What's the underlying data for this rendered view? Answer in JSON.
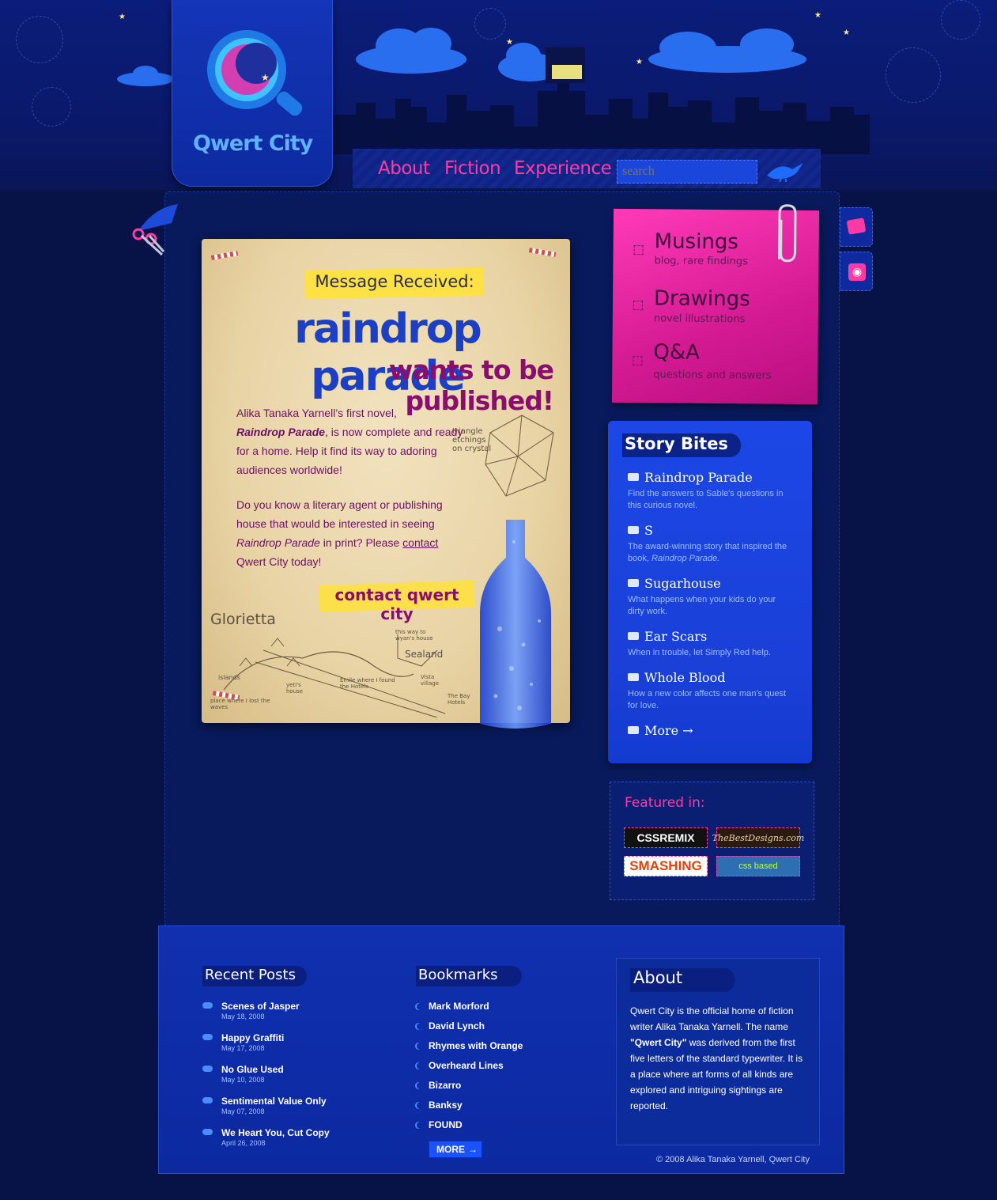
{
  "site": {
    "logo_text": "Qwert City"
  },
  "nav": {
    "items": [
      "About",
      "Fiction",
      "Experience"
    ],
    "search_placeholder": "search"
  },
  "hero": {
    "badge": "Message Received:",
    "title": "raindrop parade",
    "subtitle": "wants to be published!",
    "p1_a": "Alika Tanaka Yarnell’s first novel,",
    "p1_em": "Raindrop Parade",
    "p1_b": ", is now complete and ready for a home. Help it find its way to adoring audiences worldwide!",
    "p2_a": "Do you know a literary agent or publishing house that would be interested in seeing",
    "p2_em": "Raindrop Parade",
    "p2_b": "in print? Please",
    "p2_link": "contact",
    "p2_c": "Qwert City today!",
    "cta": "contact qwert city",
    "sketch_crystal": "triangle etchings on crystal",
    "sketch_glorietta": "Glorietta",
    "sketch_sealand": "Sealand",
    "sketch_note": "this way to wyan's house",
    "sketch_islands": "islands",
    "sketch_vista": "Vista village",
    "sketch_yetis": "yeti's house",
    "sketch_emile": "Emile where I found the Hotels",
    "sketch_bay": "The Bay Hotels",
    "sketch_place": "place where I lost the waves"
  },
  "sticky": {
    "items": [
      {
        "title": "Musings",
        "sub": "blog, rare findings"
      },
      {
        "title": "Drawings",
        "sub": "novel illustrations"
      },
      {
        "title": "Q&A",
        "sub": "questions and answers"
      }
    ]
  },
  "story_bites": {
    "heading": "Story Bites",
    "items": [
      {
        "title": "Raindrop Parade",
        "desc": "Find the answers to Sable's questions in this curious novel."
      },
      {
        "title": "S",
        "desc": "The award-winning story that inspired the book,",
        "desc_em": "Raindrop Parade."
      },
      {
        "title": "Sugarhouse",
        "desc": "What happens when your kids do your dirty work."
      },
      {
        "title": "Ear Scars",
        "desc": "When in trouble, let Simply Red help."
      },
      {
        "title": "Whole Blood",
        "desc": "How a new color affects one man's quest for love."
      }
    ],
    "more": "More"
  },
  "featured": {
    "title": "Featured in:",
    "badges": [
      "CSSREMIX",
      "TheBestDesigns.com",
      "SMASHING",
      "css based"
    ]
  },
  "footer": {
    "recent_heading": "Recent Posts",
    "recent": [
      {
        "title": "Scenes of Jasper",
        "date": "May 18, 2008"
      },
      {
        "title": "Happy Graffiti",
        "date": "May 17, 2008"
      },
      {
        "title": "No Glue Used",
        "date": "May 10, 2008"
      },
      {
        "title": "Sentimental Value Only",
        "date": "May 07, 2008"
      },
      {
        "title": "We Heart You, Cut Copy",
        "date": "April 26, 2008"
      }
    ],
    "bookmarks_heading": "Bookmarks",
    "bookmarks": [
      "Mark Morford",
      "David Lynch",
      "Rhymes with Orange",
      "Overheard Lines",
      "Bizarro",
      "Banksy",
      "FOUND"
    ],
    "more": "MORE",
    "about_heading": "About",
    "about_a": "Qwert City is the official home of fiction writer Alika Tanaka Yarnell. The name",
    "about_b": "\"Qwert City\"",
    "about_c": "was derived from the first five letters of the standard typewriter. It is a place where art forms of all kinds are explored and intriguing sightings are reported.",
    "copyright": "© 2008 Alika Tanaka Yarnell, Qwert City"
  },
  "colors": {
    "background": "#071347",
    "accent_pink": "#ff3aa4",
    "accent_blue": "#1c47e6",
    "hero_blue": "#1d3fc4",
    "hero_purple": "#8a0c6f"
  }
}
